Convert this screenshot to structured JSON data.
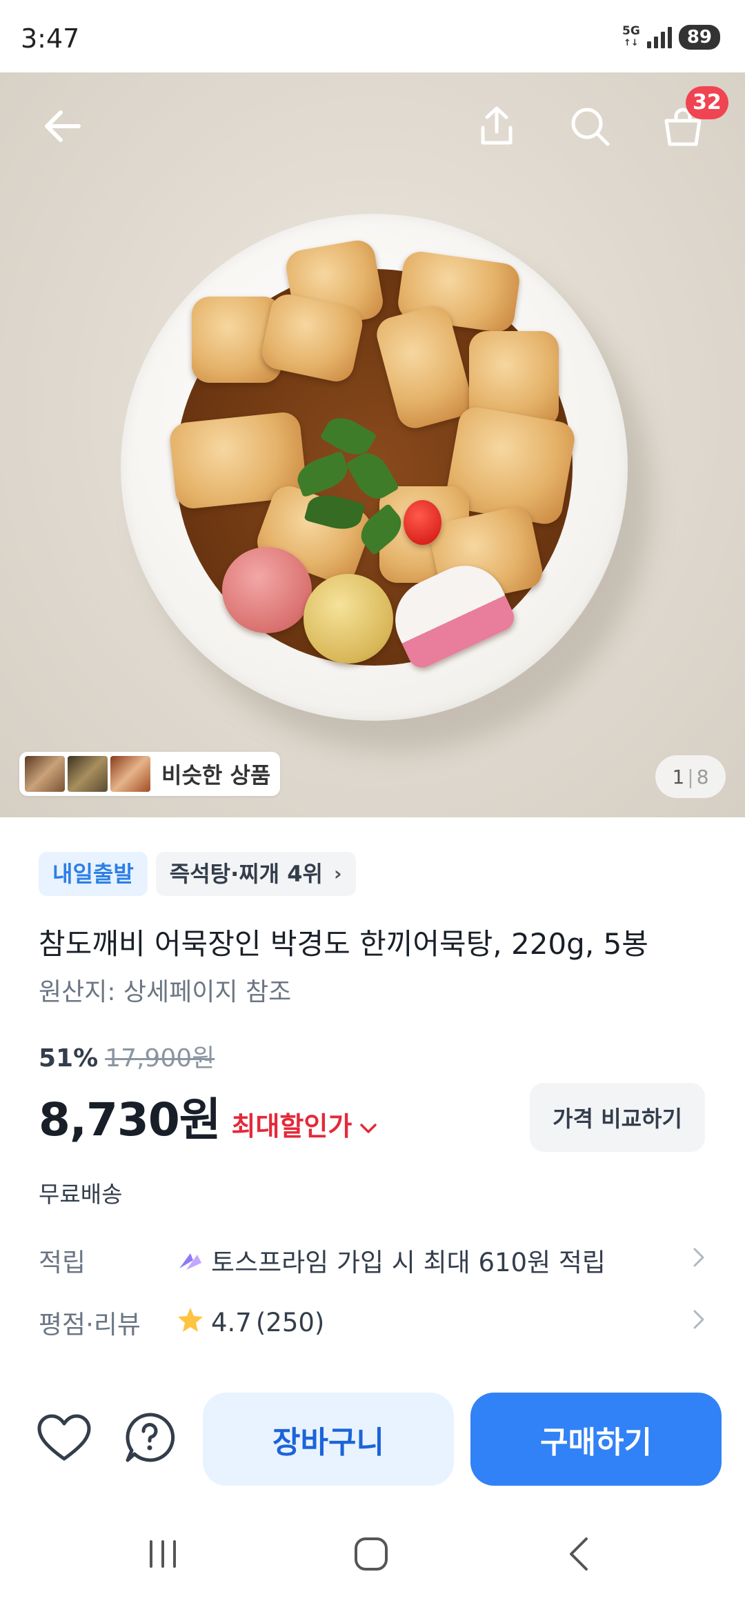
{
  "status_bar": {
    "time": "3:47",
    "network": "5G",
    "battery": "89",
    "icons": [
      "5g-icon",
      "signal-icon",
      "battery-icon"
    ]
  },
  "product_header": {
    "icons": [
      "back-arrow-icon",
      "share-icon",
      "search-icon",
      "shopping-bag-icon"
    ],
    "cart_count": "32",
    "similar_label": "비슷한 상품",
    "image_page_current": "1",
    "image_page_total": "8"
  },
  "product": {
    "badge_delivery": "내일출발",
    "badge_rank": "즉석탕·찌개 4위",
    "title": "참도깨비 어묵장인 박경도 한끼어묵탕, 220g, 5봉",
    "origin": "원산지: 상세페이지 참조",
    "discount_percent": "51%",
    "original_price": "17,900원",
    "price": "8,730원",
    "max_discount_label": "최대할인가",
    "compare_label": "가격 비교하기",
    "shipping": "무료배송"
  },
  "rows": {
    "points_label": "적립",
    "points_value": "토스프라임 가입 시 최대 610원 적립",
    "rating_label": "평점·리뷰",
    "rating_value": "4.7",
    "review_count": "(250)"
  },
  "actions": {
    "cart_label": "장바구니",
    "buy_label": "구매하기"
  },
  "colors": {
    "primary": "#3182f6",
    "accent_red": "#e42939",
    "badge_red": "#f04452",
    "star": "#ffc342"
  }
}
